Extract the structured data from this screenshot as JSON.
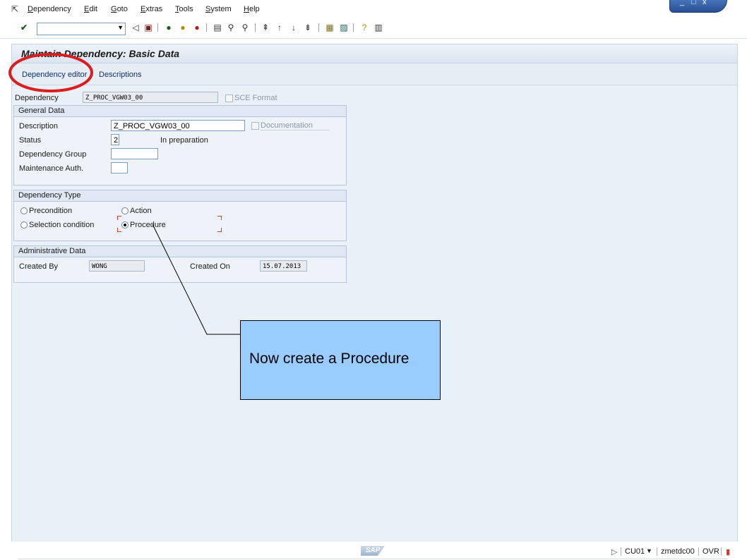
{
  "menu": {
    "items": [
      {
        "label": "Dependency"
      },
      {
        "label": "Edit"
      },
      {
        "label": "Goto"
      },
      {
        "label": "Extras"
      },
      {
        "label": "Tools"
      },
      {
        "label": "System"
      },
      {
        "label": "Help"
      }
    ],
    "window_controls": {
      "minimize": "_",
      "maximize": "□",
      "close": "x"
    }
  },
  "toolbar": {
    "command_field_value": "",
    "icons": [
      "enter-icon",
      "back-icon",
      "save-icon",
      "exit-icon",
      "cancel-icon",
      "print-icon",
      "find-icon",
      "find-next-icon",
      "first-page-icon",
      "previous-page-icon",
      "next-page-icon",
      "last-page-icon",
      "new-session-icon",
      "shortcut-icon",
      "help-icon",
      "layout-icon"
    ]
  },
  "page": {
    "title": "Maintain Dependency: Basic Data",
    "app_toolbar": {
      "dependency_editor": "Dependency editor",
      "descriptions": "Descriptions"
    }
  },
  "header_fields": {
    "dependency_label": "Dependency",
    "dependency_value": "Z_PROC_VGW03_00",
    "sce_format_label": "SCE Format",
    "sce_format_checked": false
  },
  "general_data": {
    "title": "General Data",
    "description_label": "Description",
    "description_value": "Z_PROC_VGW03_00",
    "documentation_label": "Documentation",
    "status_label": "Status",
    "status_value": "2",
    "status_text": "In preparation",
    "dependency_group_label": "Dependency Group",
    "dependency_group_value": "",
    "maintenance_auth_label": "Maintenance Auth.",
    "maintenance_auth_value": ""
  },
  "dependency_type": {
    "title": "Dependency Type",
    "options": [
      {
        "label": "Precondition",
        "selected": false
      },
      {
        "label": "Action",
        "selected": false
      },
      {
        "label": "Selection condition",
        "selected": false
      },
      {
        "label": "Procedure",
        "selected": true
      }
    ]
  },
  "administrative_data": {
    "title": "Administrative Data",
    "created_by_label": "Created By",
    "created_by_value": "WONG",
    "created_on_label": "Created On",
    "created_on_value": "15.07.2013"
  },
  "callout": {
    "text": "Now create a Procedure",
    "color": "#99ccff"
  },
  "highlight": {
    "color": "#d81e1e"
  },
  "statusbar": {
    "logo": "SAP",
    "transaction": "CU01",
    "server": "zmetdc00",
    "mode": "OVR"
  }
}
